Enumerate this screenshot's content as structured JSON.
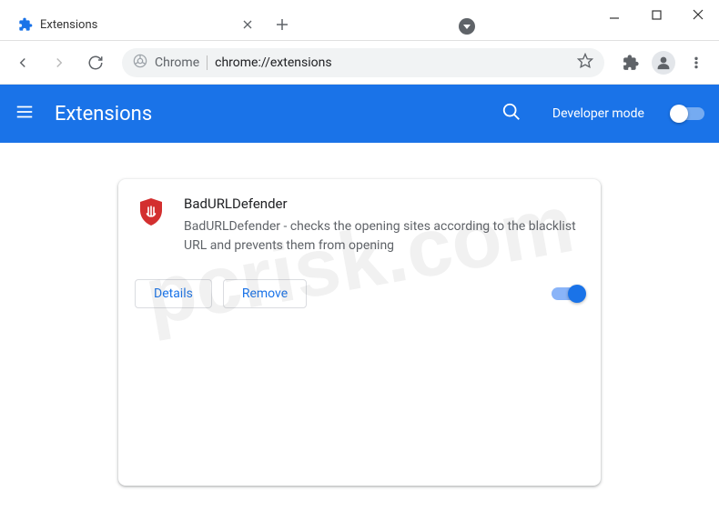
{
  "tab": {
    "title": "Extensions"
  },
  "omnibox": {
    "scheme_label": "Chrome",
    "url": "chrome://extensions"
  },
  "appbar": {
    "title": "Extensions",
    "devmode_label": "Developer mode"
  },
  "extension": {
    "name": "BadURLDefender",
    "description": "BadURLDefender - checks the opening sites according to the blacklist URL and prevents them from opening",
    "details_label": "Details",
    "remove_label": "Remove"
  },
  "watermark": "pcrisk.com"
}
